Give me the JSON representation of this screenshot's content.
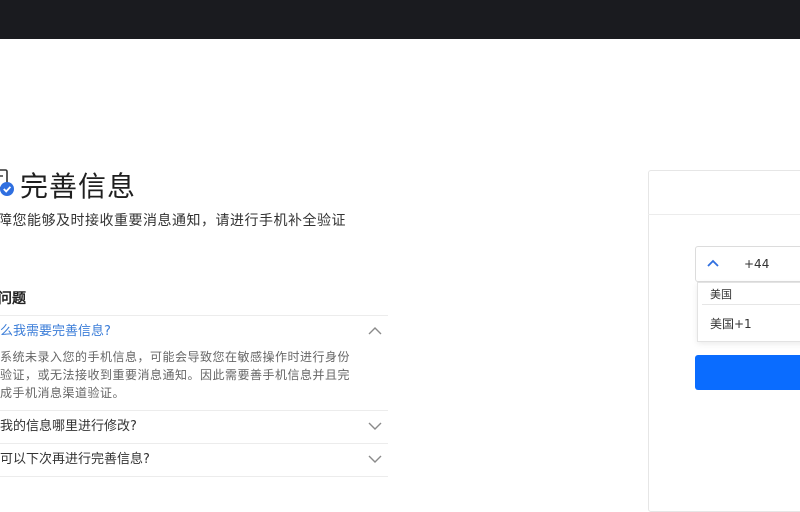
{
  "page": {
    "title": "完善信息",
    "description": "障您能够及时接收重要消息通知，请进行手机补全验证"
  },
  "faq": {
    "title": "问题",
    "items": [
      {
        "question": "么我需要完善信息?",
        "answer": "系统未录入您的手机信息，可能会导致您在敏感操作时进行身份验证，或无法接收到重要消息通知。因此需要善手机信息并且完成手机消息渠道验证。",
        "expanded": true
      },
      {
        "question": "我的信息哪里进行修改?",
        "expanded": false
      },
      {
        "question": "可以下次再进行完善信息?",
        "expanded": false
      }
    ]
  },
  "form": {
    "country_code": "+44",
    "dropdown": {
      "search_value": "美国",
      "options": [
        "美国+1"
      ]
    }
  },
  "colors": {
    "topbar": "#1a1b1f",
    "accent": "#0a6cff",
    "link": "#3b7dd8"
  },
  "icons": {
    "page_icon": "document-check-icon",
    "chevron_up": "chevron-up-icon",
    "chevron_down": "chevron-down-icon"
  }
}
